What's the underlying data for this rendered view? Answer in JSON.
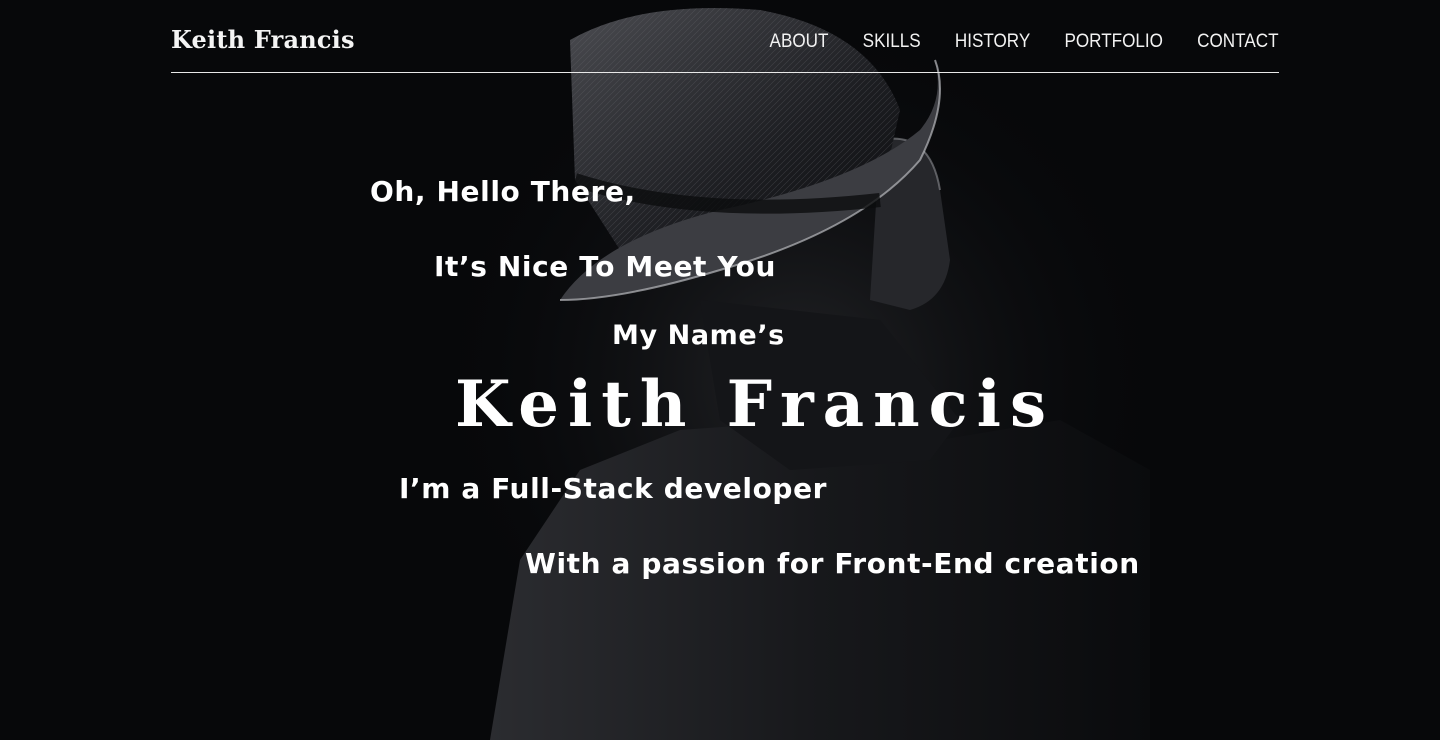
{
  "header": {
    "brand": "Keith Francis",
    "nav": [
      "ABOUT",
      "SKILLS",
      "HISTORY",
      "PORTFOLIO",
      "CONTACT"
    ]
  },
  "hero": {
    "greeting": "Oh, Hello There,",
    "nice_to_meet": "It’s Nice To Meet You",
    "my_name": "My Name’s",
    "name": "Keith Francis",
    "role": "I’m a Full-Stack developer",
    "passion": "With a passion for Front-End creation"
  },
  "colors": {
    "background": "#07080a",
    "text": "#ffffff"
  }
}
